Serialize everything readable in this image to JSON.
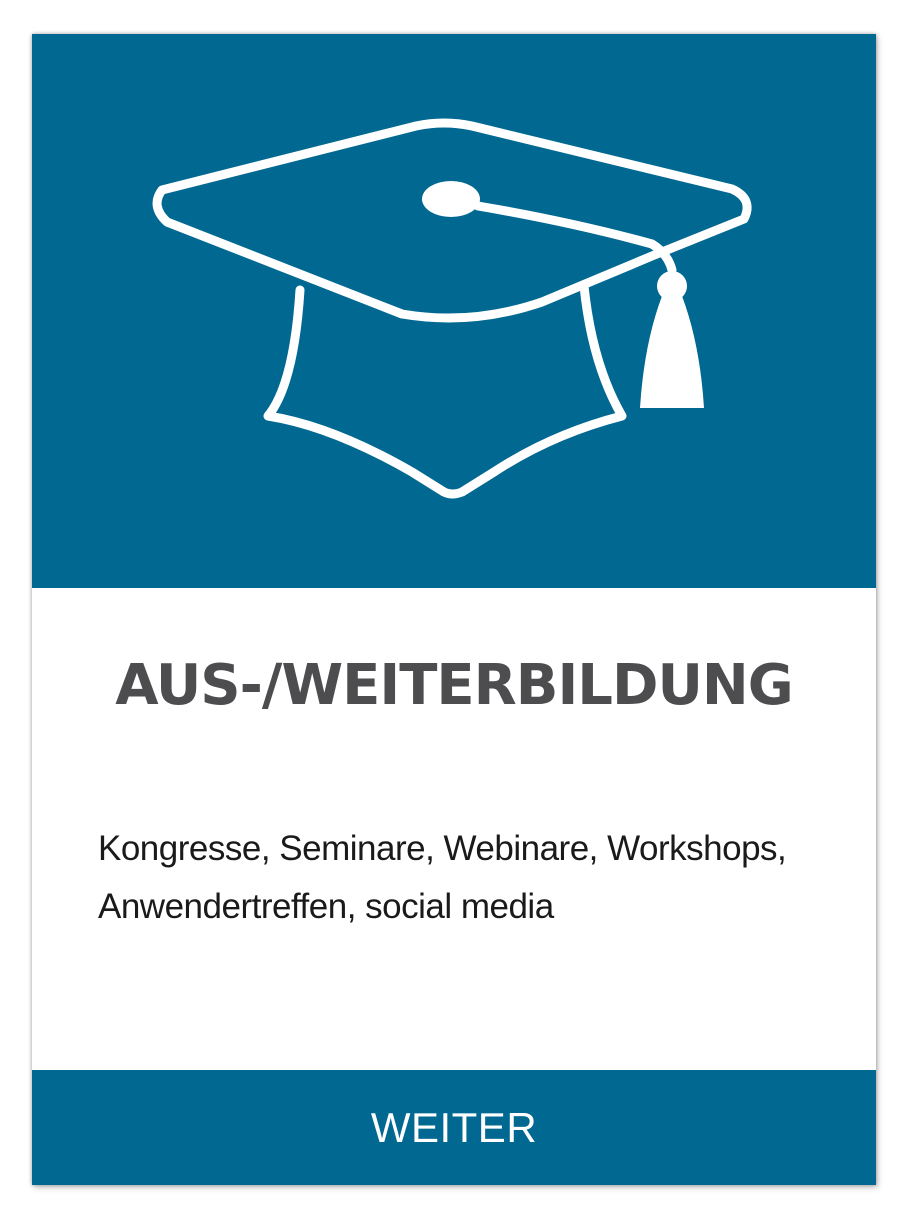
{
  "card": {
    "title": "AUS-/WEITERBILDUNG",
    "description_lines": [
      "Kongresse, Seminare, Webinare, Workshops,",
      "Anwendertreffen, social media"
    ],
    "icon": "graduation-cap-icon",
    "button_label": "WEITER"
  },
  "colors": {
    "accent": "#006891",
    "title_text": "#4d4d4f",
    "body_text": "#1a1a1a",
    "on_accent": "#ffffff"
  }
}
